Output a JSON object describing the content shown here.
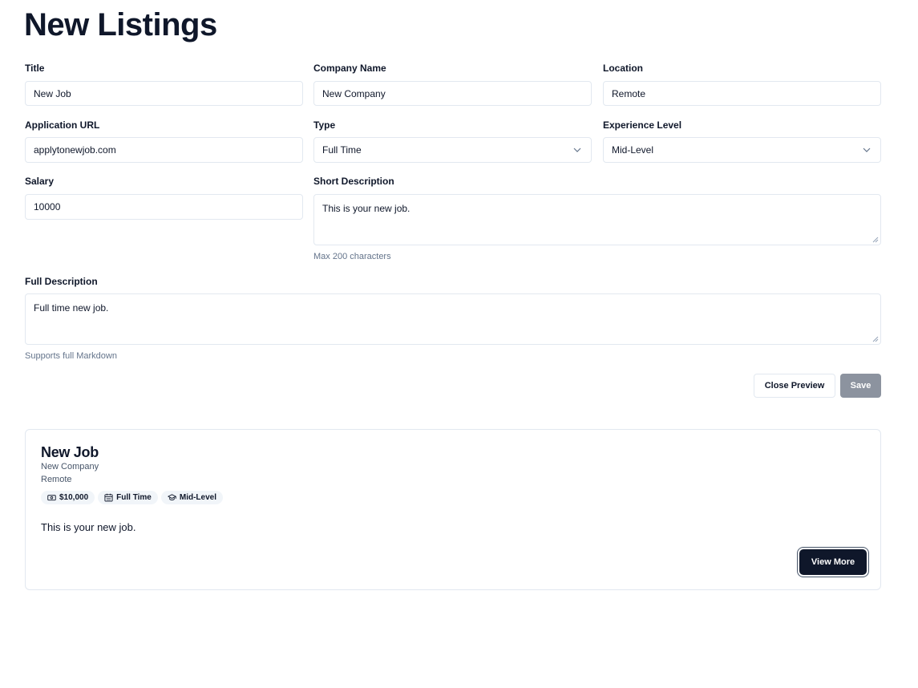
{
  "page": {
    "title": "New Listings"
  },
  "form": {
    "title": {
      "label": "Title",
      "value": "New Job"
    },
    "company_name": {
      "label": "Company Name",
      "value": "New Company"
    },
    "location": {
      "label": "Location",
      "value": "Remote"
    },
    "application_url": {
      "label": "Application URL",
      "value": "applytonewjob.com"
    },
    "type": {
      "label": "Type",
      "value": "Full Time"
    },
    "experience_level": {
      "label": "Experience Level",
      "value": "Mid-Level"
    },
    "salary": {
      "label": "Salary",
      "value": "10000"
    },
    "short_description": {
      "label": "Short Description",
      "value": "This is your new job.",
      "hint": "Max 200 characters"
    },
    "full_description": {
      "label": "Full Description",
      "value": "Full time new job.",
      "hint": "Supports full Markdown"
    }
  },
  "actions": {
    "close_preview": "Close Preview",
    "save": "Save"
  },
  "preview": {
    "title": "New Job",
    "company": "New Company",
    "location": "Remote",
    "badges": [
      {
        "icon": "banknote-icon",
        "label": "$10,000"
      },
      {
        "icon": "calendar-icon",
        "label": "Full Time"
      },
      {
        "icon": "graduation-cap-icon",
        "label": "Mid-Level"
      }
    ],
    "description": "This is your new job.",
    "view_more": "View More"
  }
}
